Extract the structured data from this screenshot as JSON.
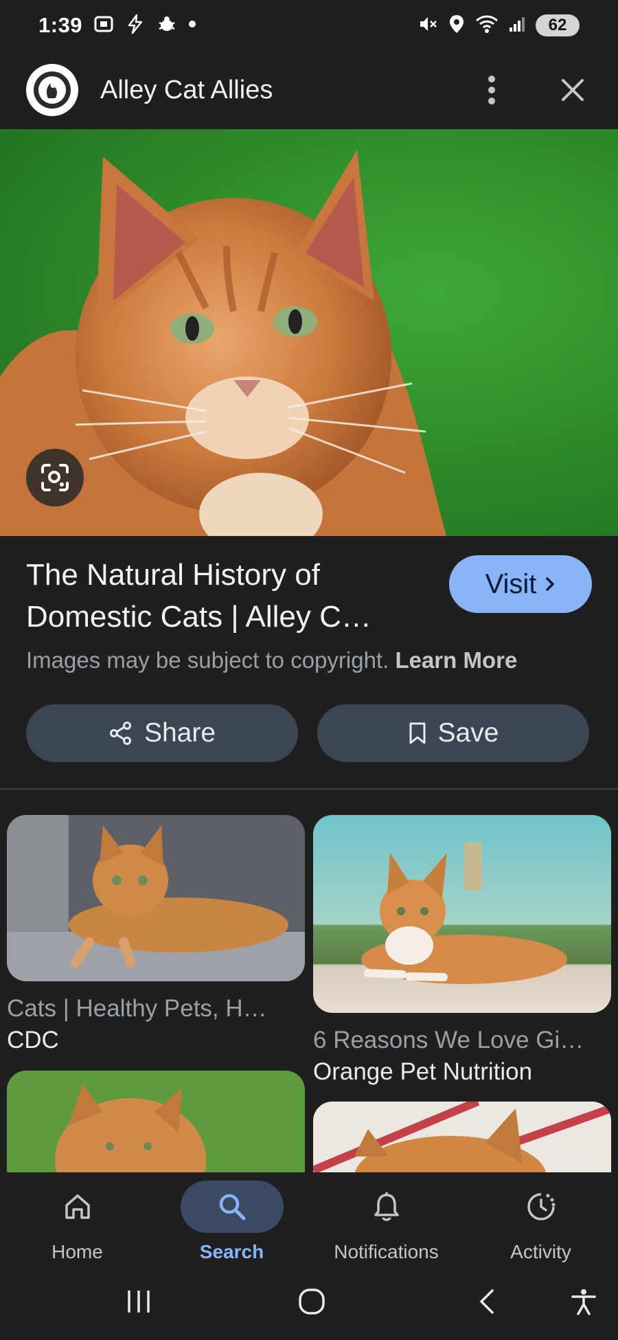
{
  "status_bar": {
    "time": "1:39",
    "battery": "62"
  },
  "header": {
    "site_name": "Alley Cat Allies",
    "more_icon": "more-vert-icon",
    "close_icon": "close-icon"
  },
  "hero": {
    "watermark": "Alley Cat Allies",
    "lens_icon": "lens-icon"
  },
  "result": {
    "title": "The Natural History of Domestic Cats | Alley C…",
    "visit_label": "Visit",
    "copyright_text": "Images may be subject to copyright.",
    "learn_more": "Learn More"
  },
  "actions": {
    "share_label": "Share",
    "save_label": "Save"
  },
  "related": [
    {
      "title": "Cats | Healthy Pets, H…",
      "source": "CDC"
    },
    {
      "title": "6 Reasons We Love Gi…",
      "source": "Orange Pet Nutrition"
    }
  ],
  "bottom_nav": {
    "items": [
      {
        "label": "Home",
        "icon": "home-icon"
      },
      {
        "label": "Search",
        "icon": "search-icon"
      },
      {
        "label": "Notifications",
        "icon": "bell-icon"
      },
      {
        "label": "Activity",
        "icon": "activity-icon"
      }
    ],
    "active": "Search"
  },
  "colors": {
    "background": "#1f1f1f",
    "accent": "#8ab4f8",
    "pill": "#3c4653"
  }
}
